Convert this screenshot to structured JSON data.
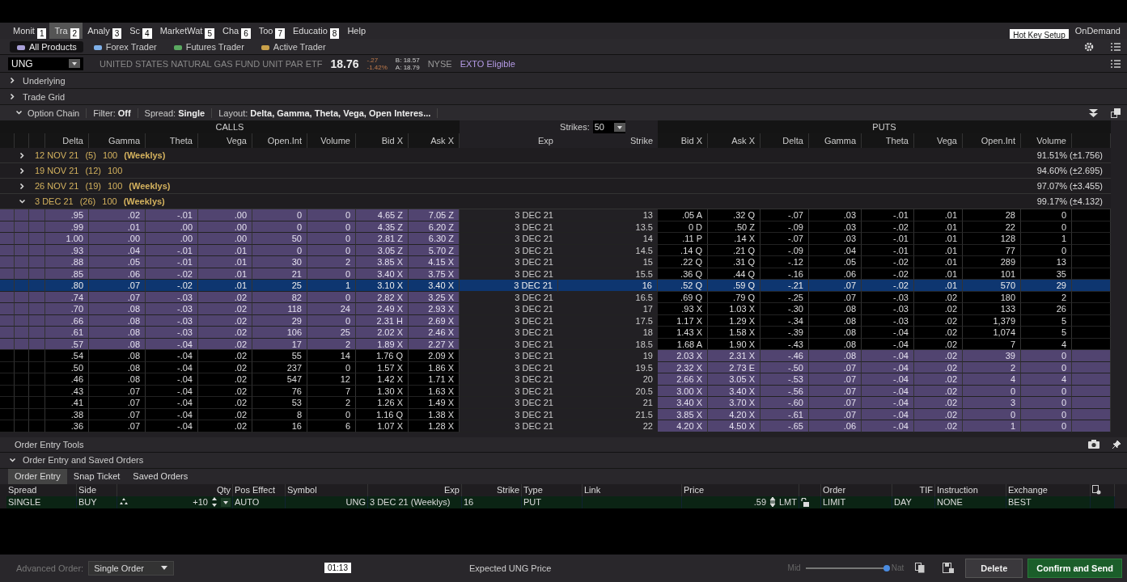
{
  "menu": [
    {
      "label": "Monit",
      "hotkey": "1",
      "selected": false
    },
    {
      "label": "Tra",
      "hotkey": "2",
      "selected": true
    },
    {
      "label": "Analy",
      "hotkey": "3",
      "selected": false
    },
    {
      "label": "Sc",
      "hotkey": "4",
      "selected": false
    },
    {
      "label": "MarketWat",
      "hotkey": "5",
      "selected": false
    },
    {
      "label": "Cha",
      "hotkey": "6",
      "selected": false
    },
    {
      "label": "Too",
      "hotkey": "7",
      "selected": false
    },
    {
      "label": "Educatio",
      "hotkey": "8",
      "selected": false
    },
    {
      "label": "Help",
      "selected": false
    }
  ],
  "tooltip": "Hot Key Setup",
  "ondemand": "OnDemand",
  "subtabs": [
    {
      "label": "All Products",
      "selected": true
    },
    {
      "label": "Forex Trader",
      "selected": false
    },
    {
      "label": "Futures Trader",
      "selected": false
    },
    {
      "label": "Active Trader",
      "selected": false
    }
  ],
  "quote": {
    "symbol": "UNG",
    "description": "UNITED STATES NATURAL GAS FUND UNIT PAR ETF",
    "last": "18.76",
    "change": "-.27",
    "change_pct": "-1.42%",
    "bid": "B: 18.57",
    "ask": "A: 18.79",
    "exchange": "NYSE",
    "badge": "EXTO Eligible"
  },
  "sections": [
    {
      "label": "Underlying",
      "expanded": false
    },
    {
      "label": "Trade Grid",
      "expanded": false
    }
  ],
  "chain": {
    "label": "Option Chain",
    "expanded": true,
    "filter_label": "Filter:",
    "filter": "Off",
    "spread_label": "Spread:",
    "spread": "Single",
    "layout_label": "Layout:",
    "layout": "Delta, Gamma, Theta, Vega, Open Interes...",
    "strikes_label": "Strikes:",
    "strikes": "50",
    "calls": "CALLS",
    "puts": "PUTS",
    "call_columns": [
      "Delta",
      "Gamma",
      "Theta",
      "Vega",
      "Open.Int",
      "Volume",
      "Bid X",
      "Ask X"
    ],
    "mid_columns": [
      "Exp",
      "Strike"
    ],
    "put_columns": [
      "Bid X",
      "Ask X",
      "Delta",
      "Gamma",
      "Theta",
      "Vega",
      "Open.Int",
      "Volume"
    ],
    "expirations": [
      {
        "date": "12 NOV 21",
        "count": "(5)",
        "multiplier": "100",
        "tag": "(Weeklys)",
        "prob": "91.51% (±1.756)",
        "expanded": false
      },
      {
        "date": "19 NOV 21",
        "count": "(12)",
        "multiplier": "100",
        "prob": "94.60% (±2.695)",
        "expanded": false
      },
      {
        "date": "26 NOV 21",
        "count": "(19)",
        "multiplier": "100",
        "tag": "(Weeklys)",
        "prob": "97.07% (±3.455)",
        "expanded": false
      },
      {
        "date": "3 DEC 21",
        "count": "(26)",
        "multiplier": "100",
        "tag": "(Weeklys)",
        "prob": "99.17% (±4.132)",
        "expanded": true
      }
    ],
    "rows": [
      {
        "exp": "3 DEC 21",
        "strike": "13",
        "call_itm": true,
        "put_itm": false,
        "selected": false,
        "call": [
          ".95",
          ".02",
          "-.01",
          ".00",
          "0",
          "0",
          "4.65 Z",
          "7.05 Z"
        ],
        "put": [
          ".05 A",
          ".32 Q",
          "-.07",
          ".03",
          "-.01",
          ".01",
          "28",
          "0"
        ]
      },
      {
        "exp": "3 DEC 21",
        "strike": "13.5",
        "call_itm": true,
        "put_itm": false,
        "selected": false,
        "call": [
          ".99",
          ".01",
          ".00",
          ".00",
          "0",
          "0",
          "4.35 Z",
          "6.20 Z"
        ],
        "put": [
          "0 D",
          ".50 Z",
          "-.09",
          ".03",
          "-.02",
          ".01",
          "22",
          "0"
        ]
      },
      {
        "exp": "3 DEC 21",
        "strike": "14",
        "call_itm": true,
        "put_itm": false,
        "selected": false,
        "call": [
          "1.00",
          ".00",
          ".00",
          ".00",
          "50",
          "0",
          "2.81 Z",
          "6.30 Z"
        ],
        "put": [
          ".11 P",
          ".14 X",
          "-.07",
          ".03",
          "-.01",
          ".01",
          "128",
          "1"
        ]
      },
      {
        "exp": "3 DEC 21",
        "strike": "14.5",
        "call_itm": true,
        "put_itm": false,
        "selected": false,
        "call": [
          ".93",
          ".04",
          "-.01",
          ".01",
          "0",
          "0",
          "3.05 Z",
          "5.70 Z"
        ],
        "put": [
          ".14 Q",
          ".21 Q",
          "-.09",
          ".04",
          "-.01",
          ".01",
          "77",
          "0"
        ]
      },
      {
        "exp": "3 DEC 21",
        "strike": "15",
        "call_itm": true,
        "put_itm": false,
        "selected": false,
        "call": [
          ".88",
          ".05",
          "-.01",
          ".01",
          "30",
          "2",
          "3.85 X",
          "4.15 X"
        ],
        "put": [
          ".22 Q",
          ".31 Q",
          "-.12",
          ".05",
          "-.02",
          ".01",
          "289",
          "13"
        ]
      },
      {
        "exp": "3 DEC 21",
        "strike": "15.5",
        "call_itm": true,
        "put_itm": false,
        "selected": false,
        "call": [
          ".85",
          ".06",
          "-.02",
          ".01",
          "21",
          "0",
          "3.40 X",
          "3.75 X"
        ],
        "put": [
          ".36 Q",
          ".44 Q",
          "-.16",
          ".06",
          "-.02",
          ".01",
          "101",
          "35"
        ]
      },
      {
        "exp": "3 DEC 21",
        "strike": "16",
        "call_itm": true,
        "put_itm": false,
        "selected": true,
        "call": [
          ".80",
          ".07",
          "-.02",
          ".01",
          "25",
          "1",
          "3.10 X",
          "3.40 X"
        ],
        "put": [
          ".52 Q",
          ".59 Q",
          "-.21",
          ".07",
          "-.02",
          ".01",
          "570",
          "29"
        ]
      },
      {
        "exp": "3 DEC 21",
        "strike": "16.5",
        "call_itm": true,
        "put_itm": false,
        "selected": false,
        "call": [
          ".74",
          ".07",
          "-.03",
          ".02",
          "82",
          "0",
          "2.82 X",
          "3.25 X"
        ],
        "put": [
          ".69 Q",
          ".79 Q",
          "-.25",
          ".07",
          "-.03",
          ".02",
          "180",
          "2"
        ]
      },
      {
        "exp": "3 DEC 21",
        "strike": "17",
        "call_itm": true,
        "put_itm": false,
        "selected": false,
        "call": [
          ".70",
          ".08",
          "-.03",
          ".02",
          "118",
          "24",
          "2.49 X",
          "2.93 X"
        ],
        "put": [
          ".93 X",
          "1.03 X",
          "-.30",
          ".08",
          "-.03",
          ".02",
          "133",
          "26"
        ]
      },
      {
        "exp": "3 DEC 21",
        "strike": "17.5",
        "call_itm": true,
        "put_itm": false,
        "selected": false,
        "call": [
          ".66",
          ".08",
          "-.03",
          ".02",
          "29",
          "0",
          "2.31 H",
          "2.69 X"
        ],
        "put": [
          "1.17 X",
          "1.29 X",
          "-.34",
          ".08",
          "-.03",
          ".02",
          "1,379",
          "5"
        ]
      },
      {
        "exp": "3 DEC 21",
        "strike": "18",
        "call_itm": true,
        "put_itm": false,
        "selected": false,
        "call": [
          ".61",
          ".08",
          "-.03",
          ".02",
          "106",
          "25",
          "2.02 X",
          "2.46 X"
        ],
        "put": [
          "1.43 X",
          "1.58 X",
          "-.39",
          ".08",
          "-.04",
          ".02",
          "1,074",
          "5"
        ]
      },
      {
        "exp": "3 DEC 21",
        "strike": "18.5",
        "call_itm": true,
        "put_itm": false,
        "selected": false,
        "call": [
          ".57",
          ".08",
          "-.04",
          ".02",
          "17",
          "2",
          "1.89 X",
          "2.27 X"
        ],
        "put": [
          "1.68 A",
          "1.90 X",
          "-.43",
          ".08",
          "-.04",
          ".02",
          "7",
          "4"
        ]
      },
      {
        "exp": "3 DEC 21",
        "strike": "19",
        "call_itm": false,
        "put_itm": true,
        "selected": false,
        "call": [
          ".54",
          ".08",
          "-.04",
          ".02",
          "55",
          "14",
          "1.76 Q",
          "2.09 X"
        ],
        "put": [
          "2.03 X",
          "2.31 X",
          "-.46",
          ".08",
          "-.04",
          ".02",
          "39",
          "0"
        ]
      },
      {
        "exp": "3 DEC 21",
        "strike": "19.5",
        "call_itm": false,
        "put_itm": true,
        "selected": false,
        "call": [
          ".50",
          ".08",
          "-.04",
          ".02",
          "237",
          "0",
          "1.57 X",
          "1.86 X"
        ],
        "put": [
          "2.32 X",
          "2.73 E",
          "-.50",
          ".07",
          "-.04",
          ".02",
          "2",
          "0"
        ]
      },
      {
        "exp": "3 DEC 21",
        "strike": "20",
        "call_itm": false,
        "put_itm": true,
        "selected": false,
        "call": [
          ".46",
          ".08",
          "-.04",
          ".02",
          "547",
          "12",
          "1.42 X",
          "1.71 X"
        ],
        "put": [
          "2.66 X",
          "3.05 X",
          "-.53",
          ".07",
          "-.04",
          ".02",
          "4",
          "4"
        ]
      },
      {
        "exp": "3 DEC 21",
        "strike": "20.5",
        "call_itm": false,
        "put_itm": true,
        "selected": false,
        "call": [
          ".43",
          ".07",
          "-.04",
          ".02",
          "76",
          "7",
          "1.30 X",
          "1.63 X"
        ],
        "put": [
          "3.00 X",
          "3.40 X",
          "-.56",
          ".07",
          "-.04",
          ".02",
          "0",
          "0"
        ]
      },
      {
        "exp": "3 DEC 21",
        "strike": "21",
        "call_itm": false,
        "put_itm": true,
        "selected": false,
        "call": [
          ".41",
          ".07",
          "-.04",
          ".02",
          "53",
          "2",
          "1.26 X",
          "1.49 X"
        ],
        "put": [
          "3.40 X",
          "3.70 X",
          "-.60",
          ".07",
          "-.04",
          ".02",
          "3",
          "0"
        ]
      },
      {
        "exp": "3 DEC 21",
        "strike": "21.5",
        "call_itm": false,
        "put_itm": true,
        "selected": false,
        "call": [
          ".38",
          ".07",
          "-.04",
          ".02",
          "8",
          "0",
          "1.16 Q",
          "1.38 X"
        ],
        "put": [
          "3.85 X",
          "4.20 X",
          "-.61",
          ".07",
          "-.04",
          ".02",
          "0",
          "0"
        ]
      },
      {
        "exp": "3 DEC 21",
        "strike": "22",
        "call_itm": false,
        "put_itm": true,
        "selected": false,
        "call": [
          ".36",
          ".07",
          "-.04",
          ".02",
          "16",
          "6",
          "1.07 X",
          "1.28 X"
        ],
        "put": [
          "4.20 X",
          "4.50 X",
          "-.65",
          ".06",
          "-.04",
          ".02",
          "1",
          "0"
        ]
      }
    ]
  },
  "tools": {
    "label": "Order Entry Tools"
  },
  "orders": {
    "label": "Order Entry and Saved Orders",
    "expanded": true,
    "tabs": [
      {
        "label": "Order Entry",
        "selected": true
      },
      {
        "label": "Snap Ticket",
        "selected": false
      },
      {
        "label": "Saved Orders",
        "selected": false
      }
    ],
    "fields": [
      {
        "header": "Spread",
        "value": "SINGLE",
        "kind": "text"
      },
      {
        "header": "Side",
        "value": "BUY",
        "kind": "text"
      },
      {
        "header": "Qty",
        "value": "+10",
        "kind": "qty"
      },
      {
        "header": "Pos Effect",
        "value": "AUTO",
        "kind": "text"
      },
      {
        "header": "Symbol",
        "value": "UNG",
        "kind": "num"
      },
      {
        "header": "Exp",
        "value": "3 DEC 21 (Weeklys)",
        "kind": "right"
      },
      {
        "header": "Strike",
        "value": "16",
        "kind": "right"
      },
      {
        "header": "Type",
        "value": "PUT",
        "kind": "text"
      },
      {
        "header": "Link",
        "kind": "text"
      },
      {
        "header": "Price",
        "value": ".59",
        "suffix": "LMT",
        "kind": "price"
      },
      {
        "kind": "lock",
        "locked": false
      },
      {
        "header": "Order",
        "value": "LIMIT",
        "kind": "text"
      },
      {
        "header": "TIF",
        "value": "DAY",
        "kind": "right"
      },
      {
        "header": "Instruction",
        "value": "NONE",
        "kind": "text"
      },
      {
        "header": "Exchange",
        "value": "BEST",
        "kind": "text"
      },
      {
        "kind": "settings"
      }
    ]
  },
  "footer": {
    "advanced_label": "Advanced Order:",
    "advanced": "Single Order",
    "timestamp": "01:13",
    "expected": "Expected UNG Price",
    "mid": "Mid",
    "nat": "Nat",
    "level": 1.0,
    "delete": "Delete",
    "confirm": "Confirm and Send"
  }
}
